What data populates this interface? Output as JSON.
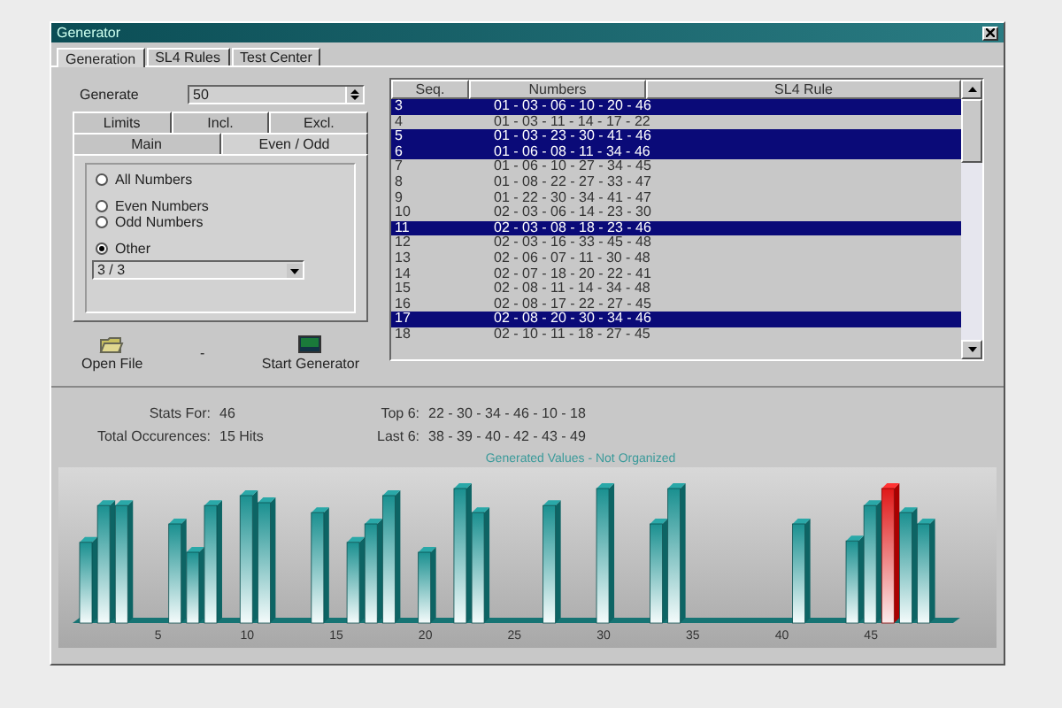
{
  "window": {
    "title": "Generator"
  },
  "tabs": [
    {
      "label": "Generation",
      "selected": true
    },
    {
      "label": "SL4 Rules",
      "selected": false
    },
    {
      "label": "Test Center",
      "selected": false
    }
  ],
  "generate": {
    "label": "Generate",
    "value": "50"
  },
  "sub_tabs_back": [
    {
      "label": "Limits",
      "selected": false
    },
    {
      "label": "Incl.",
      "selected": false
    },
    {
      "label": "Excl.",
      "selected": false
    }
  ],
  "sub_tabs_front": [
    {
      "label": "Main",
      "selected": false
    },
    {
      "label": "Even / Odd",
      "selected": true
    }
  ],
  "radios": [
    {
      "label": "All Numbers",
      "checked": false
    },
    {
      "label": "Even Numbers",
      "checked": false
    },
    {
      "label": "Odd Numbers",
      "checked": false
    },
    {
      "label": "Other",
      "checked": true
    }
  ],
  "dropdown": {
    "value": "3 / 3"
  },
  "buttons": [
    {
      "kind": "open",
      "label": "Open File"
    },
    {
      "kind": "plain",
      "label": "-"
    },
    {
      "kind": "start",
      "label": "Start Generator"
    }
  ],
  "list": {
    "columns": [
      "Seq.",
      "Numbers",
      "SL4 Rule"
    ],
    "rows": [
      {
        "seq": "3",
        "numbers": "01 - 03 - 06 - 10 - 20 - 46",
        "selected": true
      },
      {
        "seq": "4",
        "numbers": "01 - 03 - 11 - 14 - 17 - 22",
        "selected": false
      },
      {
        "seq": "5",
        "numbers": "01 - 03 - 23 - 30 - 41 - 46",
        "selected": true
      },
      {
        "seq": "6",
        "numbers": "01 - 06 - 08 - 11 - 34 - 46",
        "selected": true
      },
      {
        "seq": "7",
        "numbers": "01 - 06 - 10 - 27 - 34 - 45",
        "selected": false
      },
      {
        "seq": "8",
        "numbers": "01 - 08 - 22 - 27 - 33 - 47",
        "selected": false
      },
      {
        "seq": "9",
        "numbers": "01 - 22 - 30 - 34 - 41 - 47",
        "selected": false
      },
      {
        "seq": "10",
        "numbers": "02 - 03 - 06 - 14 - 23 - 30",
        "selected": false
      },
      {
        "seq": "11",
        "numbers": "02 - 03 - 08 - 18 - 23 - 46",
        "selected": true
      },
      {
        "seq": "12",
        "numbers": "02 - 03 - 16 - 33 - 45 - 48",
        "selected": false
      },
      {
        "seq": "13",
        "numbers": "02 - 06 - 07 - 11 - 30 - 48",
        "selected": false
      },
      {
        "seq": "14",
        "numbers": "02 - 07 - 18 - 20 - 22 - 41",
        "selected": false
      },
      {
        "seq": "15",
        "numbers": "02 - 08 - 11 - 14 - 34 - 48",
        "selected": false
      },
      {
        "seq": "16",
        "numbers": "02 - 08 - 17 - 22 - 27 - 45",
        "selected": false
      },
      {
        "seq": "17",
        "numbers": "02 - 08 - 20 - 30 - 34 - 46",
        "selected": true
      },
      {
        "seq": "18",
        "numbers": "02 - 10 - 11 - 18 - 27 - 45",
        "selected": false
      }
    ]
  },
  "stats": {
    "stats_for_label": "Stats For:",
    "stats_for": "46",
    "total_label": "Total Occurences:",
    "total": "15 Hits",
    "top_label": "Top 6:",
    "top": "22 - 30 - 34 - 46 - 10 - 18",
    "last_label": "Last 6:",
    "last": "38 - 39 - 40 - 42 - 43 - 49"
  },
  "chart": {
    "title": "Generated Values - Not Organized",
    "x_labels": [
      "5",
      "10",
      "15",
      "20",
      "25",
      "30",
      "35",
      "40",
      "45"
    ]
  }
}
